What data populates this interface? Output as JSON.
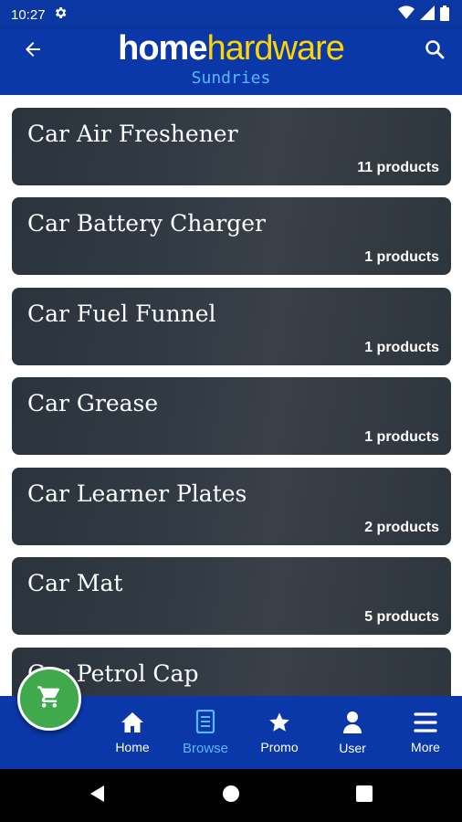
{
  "status_bar": {
    "time": "10:27",
    "settings_icon": "gear-icon",
    "wifi_icon": "wifi-icon",
    "signal_icon": "signal-icon",
    "battery_icon": "battery-icon"
  },
  "header": {
    "logo_home": "home",
    "logo_hardware": "hardware",
    "subtitle": "Sundries",
    "back_icon": "arrow-back-icon",
    "search_icon": "search-icon"
  },
  "categories": [
    {
      "name": "Car Air Freshener",
      "count": "11 products"
    },
    {
      "name": "Car Battery Charger",
      "count": "1 products"
    },
    {
      "name": "Car Fuel Funnel",
      "count": "1 products"
    },
    {
      "name": "Car Grease",
      "count": "1 products"
    },
    {
      "name": "Car Learner Plates",
      "count": "2 products"
    },
    {
      "name": "Car Mat",
      "count": "5 products"
    },
    {
      "name": "Car Petrol Cap",
      "count": ""
    }
  ],
  "bottom_nav": {
    "items": [
      {
        "label": "Home",
        "icon": "home-icon"
      },
      {
        "label": "Browse",
        "icon": "browse-icon",
        "active": true
      },
      {
        "label": "Promo",
        "icon": "star-icon"
      },
      {
        "label": "User",
        "icon": "user-icon"
      },
      {
        "label": "More",
        "icon": "menu-icon"
      }
    ]
  },
  "fab": {
    "icon": "cart-icon"
  },
  "colors": {
    "brand_blue": "#0a38a8",
    "logo_yellow": "#ffd400",
    "accent_blue": "#57b8ff",
    "fab_green": "#3fa94b"
  }
}
